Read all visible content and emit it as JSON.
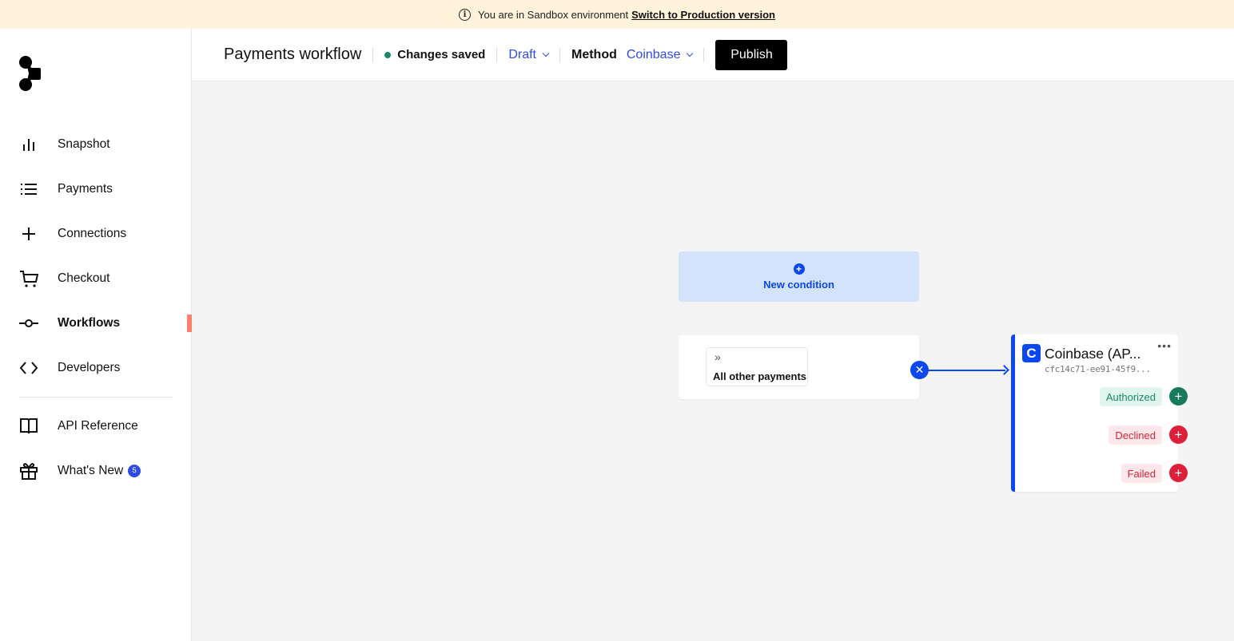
{
  "banner": {
    "icon": "info-icon",
    "message": "You are in Sandbox environment",
    "link": "Switch to Production version"
  },
  "sidebar": {
    "logo": "brand-logo",
    "items": [
      {
        "label": "Snapshot",
        "icon": "bar-chart-icon",
        "active": false
      },
      {
        "label": "Payments",
        "icon": "list-icon",
        "active": false
      },
      {
        "label": "Connections",
        "icon": "plus-icon",
        "active": false
      },
      {
        "label": "Checkout",
        "icon": "cart-icon",
        "active": false
      },
      {
        "label": "Workflows",
        "icon": "workflow-icon",
        "active": true
      },
      {
        "label": "Developers",
        "icon": "code-icon",
        "active": false
      },
      {
        "label": "API Reference",
        "icon": "book-icon",
        "active": false
      },
      {
        "label": "What's New",
        "icon": "gift-icon",
        "active": false,
        "badge": "5"
      }
    ]
  },
  "header": {
    "title": "Payments workflow",
    "status": "Changes saved",
    "status_color": "#178a69",
    "version": "Draft",
    "method_label": "Method",
    "method_value": "Coinbase",
    "publish_label": "Publish"
  },
  "canvas": {
    "new_condition": "New condition",
    "condition": {
      "label": "All other payments",
      "icon": "chevrons-right-icon"
    },
    "provider": {
      "name": "Coinbase (AP...",
      "id": "cfc14c71-ee91-45f9...",
      "accent": "#0b47ef",
      "outcomes": [
        {
          "label": "Authorized",
          "type": "success"
        },
        {
          "label": "Declined",
          "type": "error"
        },
        {
          "label": "Failed",
          "type": "error"
        }
      ]
    }
  }
}
